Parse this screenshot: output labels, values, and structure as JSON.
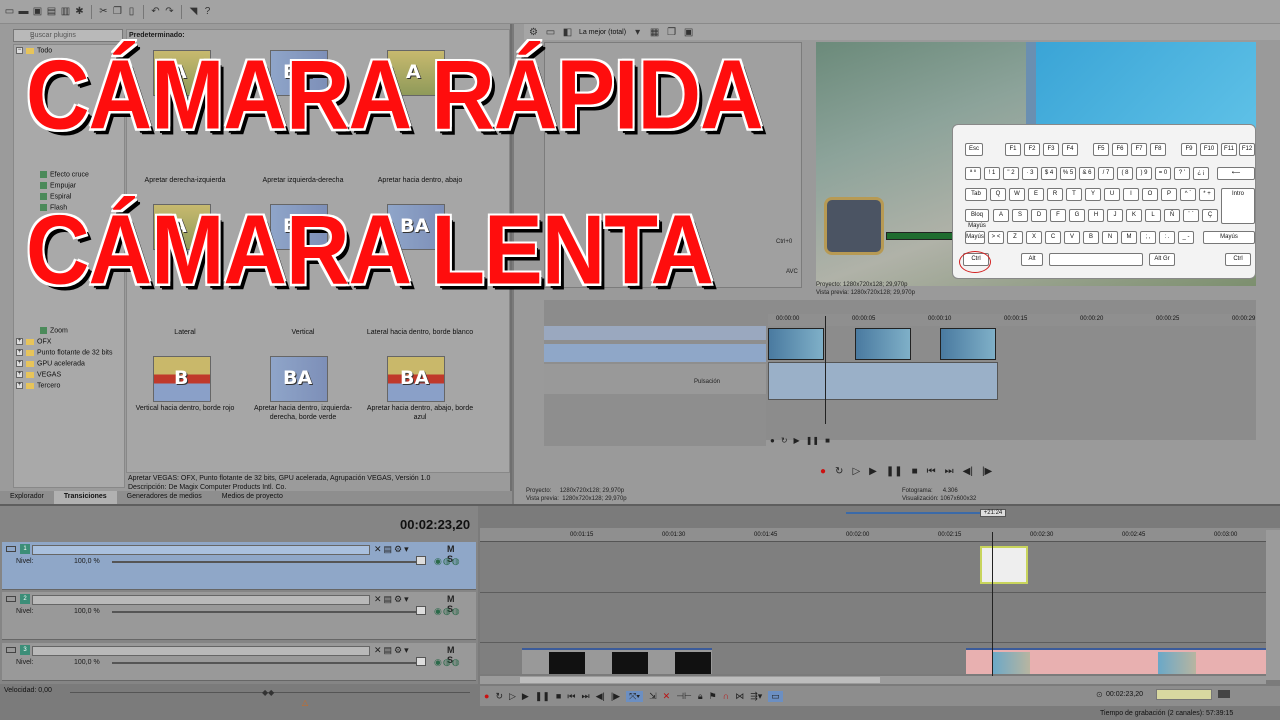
{
  "toolbar": {
    "icons": [
      "new-icon",
      "open-icon",
      "save-icon",
      "save-as-icon",
      "render-icon",
      "properties-icon",
      "cut-icon",
      "copy-icon",
      "paste-icon",
      "undo-icon",
      "redo-icon",
      "split-icon",
      "help-icon"
    ]
  },
  "plugin_panel": {
    "search_placeholder": "Buscar plugins",
    "tree": [
      {
        "label": "Todo",
        "type": "folder",
        "expanded": true
      },
      {
        "label": "Efecto cruce",
        "type": "leaf"
      },
      {
        "label": "Empujar",
        "type": "leaf"
      },
      {
        "label": "Espiral",
        "type": "leaf"
      },
      {
        "label": "Flash",
        "type": "leaf"
      },
      {
        "label": "Zoom",
        "type": "leaf"
      },
      {
        "label": "OFX",
        "type": "folder"
      },
      {
        "label": "Punto flotante de 32 bits",
        "type": "folder"
      },
      {
        "label": "GPU acelerada",
        "type": "folder"
      },
      {
        "label": "VEGAS",
        "type": "folder"
      },
      {
        "label": "Tercero",
        "type": "folder"
      }
    ],
    "presets_header": "Predeterminado:",
    "presets": [
      {
        "label": "Apretar derecha-izquierda",
        "glyph": "A"
      },
      {
        "label": "Apretar izquierda-derecha",
        "glyph": "BA"
      },
      {
        "label": "Apretar hacia dentro, abajo",
        "glyph": "A"
      },
      {
        "label": "Lateral",
        "glyph": "A"
      },
      {
        "label": "Vertical",
        "glyph": "BA"
      },
      {
        "label": "Lateral hacia dentro, borde blanco",
        "glyph": "BA"
      },
      {
        "label": "Vertical hacia dentro, borde rojo",
        "glyph": "B"
      },
      {
        "label": "Apretar hacia dentro, izquierda-derecha, borde verde",
        "glyph": "BA"
      },
      {
        "label": "Apretar hacia dentro, abajo, borde azul",
        "glyph": "BA"
      }
    ],
    "status_line1": "Apretar VEGAS: OFX, Punto flotante de 32 bits, GPU acelerada, Agrupación VEGAS, Versión 1.0",
    "status_line2": "Descripción: De Magix Computer Products Intl. Co.",
    "tabs": [
      "Explorador",
      "Transiciones",
      "Generadores de medios",
      "Medios de proyecto"
    ],
    "active_tab": "Transiciones"
  },
  "preview": {
    "quality": "La mejor (total)",
    "project_label": "Proyecto:",
    "project_value": "1280x720x128; 29,970p",
    "preview_label": "Vista previa:",
    "preview_value": "1280x720x128; 29,970p",
    "frame_label": "Fotograma:",
    "frame_value": "4.306",
    "display_label": "Visualización:",
    "display_value": "1067x600x32",
    "ctrl_key_hint": "Ctrl+0",
    "codec_hint": "AVC"
  },
  "keyboard": {
    "fkeys": [
      "Esc",
      "F1",
      "F2",
      "F3",
      "F4",
      "F5",
      "F6",
      "F7",
      "F8",
      "F9",
      "F10",
      "F11",
      "F12"
    ],
    "row1": [
      "ª º",
      "! 1",
      "\" 2",
      "· 3",
      "$ 4",
      "% 5",
      "& 6",
      "/ 7",
      "( 8",
      ") 9",
      "= 0",
      "? '",
      "¿ ¡"
    ],
    "row2": [
      "Q",
      "W",
      "E",
      "R",
      "T",
      "Y",
      "U",
      "I",
      "O",
      "P",
      "^ `",
      "* +"
    ],
    "row3": [
      "A",
      "S",
      "D",
      "F",
      "G",
      "H",
      "J",
      "K",
      "L",
      "Ñ",
      "¨ ´",
      "Ç"
    ],
    "row4": [
      "> <",
      "Z",
      "X",
      "C",
      "V",
      "B",
      "N",
      "M",
      "; ,",
      ": .",
      "_ -"
    ],
    "modifiers": [
      "Ctrl",
      "Alt",
      "Alt Gr",
      "Ctrl"
    ],
    "labels": {
      "tab": "Tab",
      "caps": "Bloq Mayús",
      "shift": "Mayús",
      "shift_r": "Mayús",
      "enter": "Intro"
    }
  },
  "overlay": {
    "line1": "CÁMARA RÁPIDA",
    "line2": "CÁMARA LENTA"
  },
  "timeline": {
    "timecode": "00:02:23,20",
    "playhead_badge": "+21:24",
    "ruler": [
      "00:01:15",
      "00:01:30",
      "00:01:45",
      "00:02:00",
      "00:02:15",
      "00:02:30",
      "00:02:45",
      "00:03:00"
    ],
    "tracks": [
      {
        "number": "1",
        "level_label": "Nivel:",
        "level_value": "100,0 %",
        "selected": true
      },
      {
        "number": "2",
        "level_label": "Nivel:",
        "level_value": "100,0 %",
        "selected": false
      },
      {
        "number": "3",
        "level_label": "Nivel:",
        "level_value": "100,0 %",
        "selected": false
      }
    ],
    "mute_solo": "M S",
    "speed": "Velocidad: 0,00",
    "end_time": "00:02:23,20",
    "record_time": "Tiempo de grabación (2 canales): 57:39:15"
  },
  "mini_timeline": {
    "ticks": [
      "00:00:00",
      "00:00:05",
      "00:00:10",
      "00:00:15",
      "00:00:20",
      "00:00:25",
      "00:00:29"
    ],
    "pulse_label": "Pulsación"
  }
}
